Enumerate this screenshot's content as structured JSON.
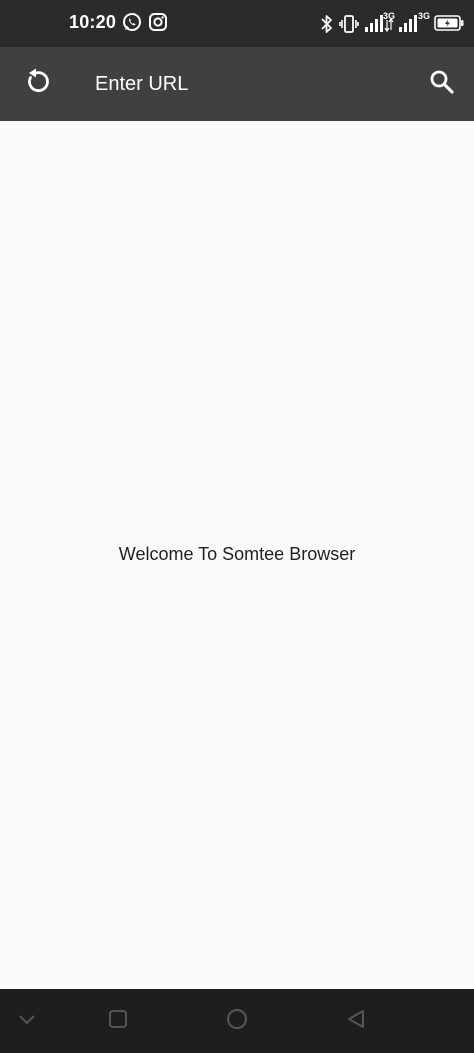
{
  "status_bar": {
    "time": "10:20",
    "icons": [
      "whatsapp-icon",
      "instagram-icon",
      "bluetooth-icon",
      "vibrate-icon",
      "signal-3g-icon",
      "signal-3g-icon",
      "battery-icon"
    ],
    "network_label_1": "3G",
    "network_label_2": "3G"
  },
  "app_bar": {
    "reload_icon": "reload-icon",
    "url_placeholder": "Enter URL",
    "search_icon": "search-icon",
    "background": "#404040"
  },
  "content": {
    "welcome_text": "Welcome To Somtee Browser"
  },
  "nav_bar": {
    "buttons": [
      "chevron-down-icon",
      "recents-icon",
      "home-icon",
      "back-icon"
    ]
  }
}
